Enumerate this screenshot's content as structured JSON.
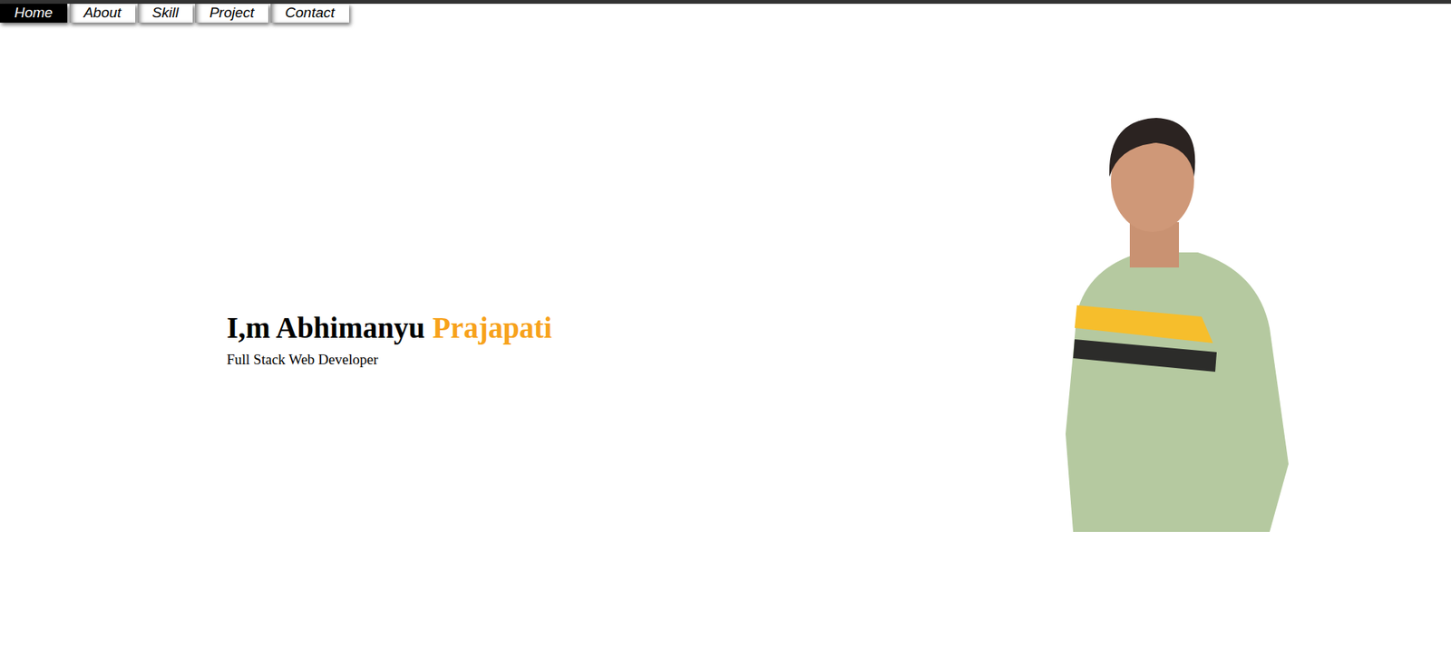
{
  "nav": [
    {
      "label": "Home",
      "selected": true
    },
    {
      "label": "About",
      "selected": false
    },
    {
      "label": "Skill",
      "selected": false
    },
    {
      "label": "Project",
      "selected": false
    },
    {
      "label": "Contact",
      "selected": false
    }
  ],
  "hero": {
    "name": "I,m Abhimanyu",
    "highlight": "Prajapati",
    "subtitle": "Full Stack Web Developer"
  }
}
